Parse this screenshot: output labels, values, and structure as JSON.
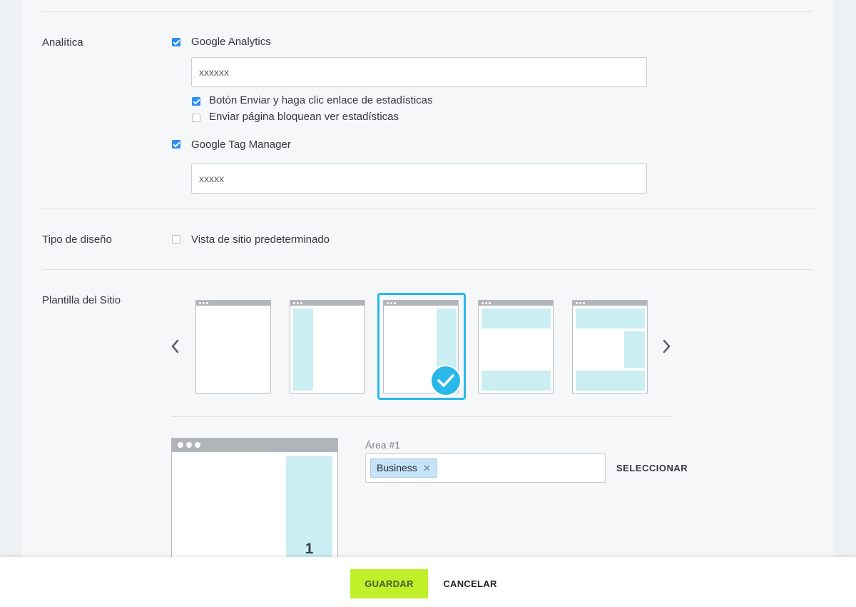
{
  "analytics": {
    "section_label": "Analítica",
    "google_analytics": {
      "label": "Google Analytics",
      "checked": true,
      "value": "xxxxxx"
    },
    "sub_options": [
      {
        "label": "Botón Enviar y haga clic enlace de estadísticas",
        "checked": true
      },
      {
        "label": "Enviar página bloquean ver estadísticas",
        "checked": false
      }
    ],
    "google_tag_manager": {
      "label": "Google Tag Manager",
      "checked": true,
      "value": "xxxxx"
    }
  },
  "design_type": {
    "section_label": "Tipo de diseño",
    "default_view": {
      "label": "Vista de sitio predeterminado",
      "checked": false
    }
  },
  "site_template": {
    "section_label": "Plantilla del Sitio",
    "prev_icon": "chevron-left-icon",
    "next_icon": "chevron-right-icon",
    "selected_template": 3,
    "templates": [
      "blank",
      "left-sidebar",
      "right-sidebar",
      "header-footer",
      "header-right-footer"
    ],
    "preview_area_number": "1",
    "area_label": "Área #1",
    "area_tag": "Business",
    "select_label": "SELECCIONAR"
  },
  "colors": {
    "accent_check": "#2a8df0",
    "selected_border": "#29b8e8",
    "block_fill": "#caeef2",
    "save_button": "#bef12a"
  },
  "footer": {
    "save_label": "GUARDAR",
    "cancel_label": "CANCELAR"
  }
}
